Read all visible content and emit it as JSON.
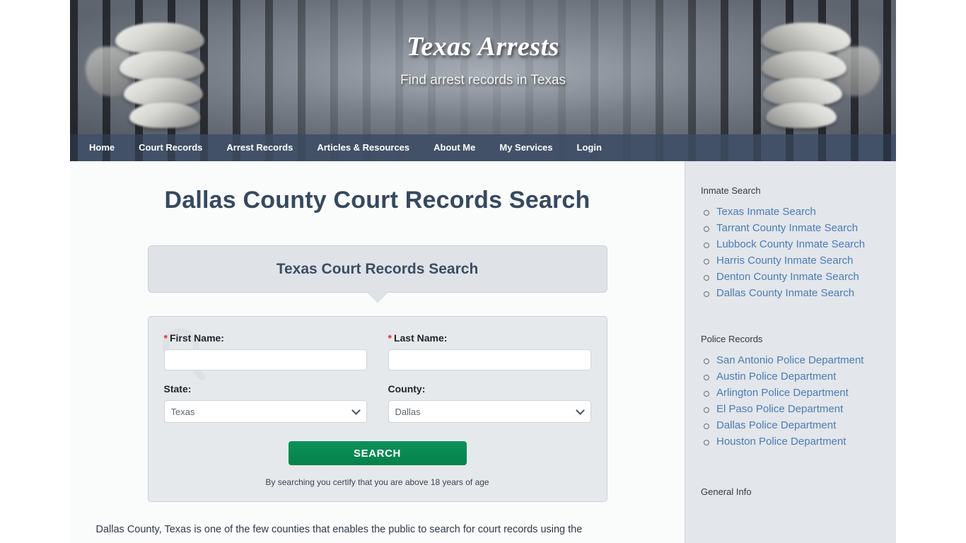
{
  "site": {
    "title": "Texas Arrests",
    "tagline": "Find arrest records in Texas"
  },
  "nav": {
    "items": [
      {
        "label": "Home"
      },
      {
        "label": "Court Records"
      },
      {
        "label": "Arrest Records"
      },
      {
        "label": "Articles & Resources"
      },
      {
        "label": "About Me"
      },
      {
        "label": "My Services"
      },
      {
        "label": "Login"
      }
    ]
  },
  "main": {
    "page_title": "Dallas County Court Records Search",
    "widget_title": "Texas Court Records Search",
    "form": {
      "first_name_label": "First Name:",
      "last_name_label": "Last Name:",
      "state_label": "State:",
      "county_label": "County:",
      "required_marker": "*",
      "first_name_value": "",
      "last_name_value": "",
      "first_name_placeholder": "",
      "last_name_placeholder": "",
      "state_value": "Texas",
      "county_value": "Dallas",
      "state_options": [
        "Texas"
      ],
      "county_options": [
        "Dallas"
      ],
      "submit_label": "SEARCH",
      "disclaimer": "By searching you certify that you are above 18 years of age"
    },
    "paragraph": "Dallas County, Texas is one of the few counties that enables the public to search for court records using the"
  },
  "sidebar": {
    "sections": [
      {
        "heading": "Inmate Search",
        "links": [
          "Texas Inmate Search",
          "Tarrant County Inmate Search",
          "Lubbock County Inmate Search",
          "Harris County Inmate Search",
          "Denton County Inmate Search",
          "Dallas County Inmate Search"
        ]
      },
      {
        "heading": "Police Records",
        "links": [
          "San Antonio Police Department",
          "Austin Police Department",
          "Arlington Police Department",
          "El Paso Police Department",
          "Dallas Police Department",
          "Houston Police Department"
        ]
      },
      {
        "heading": "General Info",
        "links": []
      }
    ]
  },
  "colors": {
    "heading": "#36495f",
    "nav_bg": "#283952",
    "sidebar_bg": "#e3e6ea",
    "link": "#4a7bb7",
    "button": "#0b8a54",
    "required": "#e8291d"
  },
  "icons": {
    "dropdown": "chevron-down-icon",
    "watermark": "magnifier-icon",
    "bullet": "circle-bullet-icon"
  }
}
